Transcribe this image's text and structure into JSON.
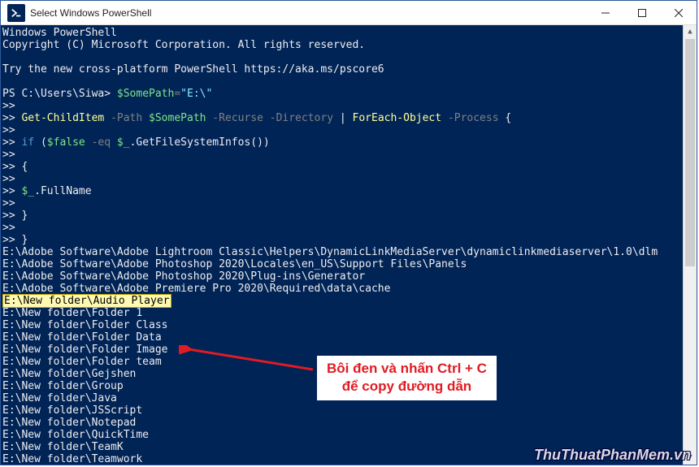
{
  "titlebar": {
    "title": "Select Windows PowerShell"
  },
  "console": {
    "header1": "Windows PowerShell",
    "header2": "Copyright (C) Microsoft Corporation. All rights reserved.",
    "try_line": "Try the new cross-platform PowerShell https://aka.ms/pscore6",
    "prompt_prefix": "PS C:\\Users\\Siwa> ",
    "cmd_var": "$SomePath",
    "cmd_assign": "=",
    "cmd_string": "\"E:\\\"",
    "cont": ">>",
    "l_getchild": "Get-ChildItem",
    "l_path": " -Path ",
    "l_recurse": " -Recurse -Directory",
    "l_pipe": " | ",
    "l_foreach": "ForEach-Object",
    "l_process": " -Process ",
    "l_open": "{",
    "l_if": "if",
    "l_if_paren": " (",
    "l_false": "$false",
    "l_eq": " -eq ",
    "l_underscore": "$_",
    "l_method": ".GetFileSystemInfos())",
    "l_fullname": ".FullName",
    "l_close": " }",
    "out1": "E:\\Adobe Software\\Adobe Lightroom Classic\\Helpers\\DynamicLinkMediaServer\\dynamiclinkmediaserver\\1.0\\dlm",
    "out2": "E:\\Adobe Software\\Adobe Photoshop 2020\\Locales\\en_US\\Support Files\\Panels",
    "out3": "E:\\Adobe Software\\Adobe Photoshop 2020\\Plug-ins\\Generator",
    "out4": "E:\\Adobe Software\\Adobe Premiere Pro 2020\\Required\\data\\cache",
    "out5_sel": "E:\\New folder\\Audio Player",
    "out6": "E:\\New folder\\Folder 1",
    "out7": "E:\\New folder\\Folder Class",
    "out8": "E:\\New folder\\Folder Data",
    "out9": "E:\\New folder\\Folder Image",
    "out10": "E:\\New folder\\Folder team",
    "out11": "E:\\New folder\\Gejshen",
    "out12": "E:\\New folder\\Group",
    "out13": "E:\\New folder\\Java",
    "out14": "E:\\New folder\\JSScript",
    "out15": "E:\\New folder\\Notepad",
    "out16": "E:\\New folder\\QuickTime",
    "out17": "E:\\New folder\\TeamK",
    "out18": "E:\\New folder\\Teamwork"
  },
  "annotation": {
    "line1": "Bôi đen và nhấn Ctrl + C",
    "line2": "để copy đường dẫn"
  },
  "watermark": "ThuThuatPhanMem.vn"
}
